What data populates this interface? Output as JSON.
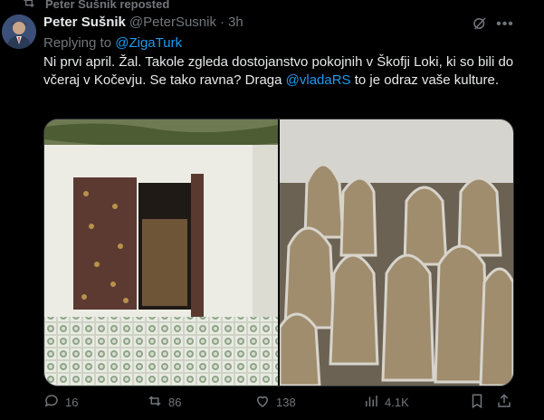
{
  "repost": {
    "label": "Peter Sušnik reposted"
  },
  "author": {
    "name": "Peter Sušnik",
    "handle": "@PeterSusnik",
    "separator": "·",
    "time": "3h"
  },
  "reply": {
    "prefix": "Replying to",
    "mention": "@ZigaTurk"
  },
  "text": {
    "part1": "Ni prvi april. Žal. Takole zgleda dostojanstvo pokojnih v Škofji Loki, ki so bili do včeraj v Kočevju. Se tako ravna? Draga ",
    "mention": "@vladaRS",
    "part2": " to je odraz vaše kulture."
  },
  "actions": {
    "replies": "16",
    "reposts": "86",
    "likes": "138",
    "views": "4.1K"
  },
  "icons": [
    "repost-icon",
    "grok-icon",
    "more-icon",
    "reply-icon",
    "retweet-icon",
    "like-icon",
    "views-icon",
    "bookmark-icon",
    "share-icon"
  ],
  "colors": {
    "background": "#000000",
    "text": "#e7e9ea",
    "muted": "#71767b",
    "link": "#1d9bf0"
  }
}
